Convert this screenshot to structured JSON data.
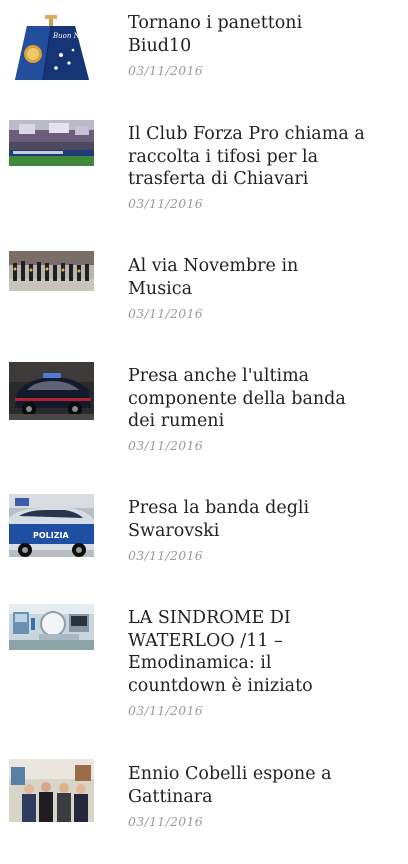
{
  "news": [
    {
      "title": "Tornano i panettoni\nBiud10",
      "date": "03/11/2016",
      "thumbnail_icon": "panettone-box-image",
      "logo_text": "Buon Natale"
    },
    {
      "title": "Il Club Forza Pro chiama a\nraccolta i tifosi per la\ntrasferta di Chiavari",
      "date": "03/11/2016",
      "thumbnail_icon": "stadium-fans-image"
    },
    {
      "title": "Al via Novembre in\nMusica",
      "date": "03/11/2016",
      "thumbnail_icon": "marching-band-image"
    },
    {
      "title": "Presa anche l'ultima\ncomponente della banda\ndei rumeni",
      "date": "03/11/2016",
      "thumbnail_icon": "carabinieri-car-image"
    },
    {
      "title": "Presa la banda degli\nSwarovski",
      "date": "03/11/2016",
      "thumbnail_icon": "police-car-image",
      "car_text": "POLIZIA"
    },
    {
      "title": "LA SINDROME DI\nWATERLOO /11 –\nEmodinamica: il\ncountdown è iniziato",
      "date": "03/11/2016",
      "thumbnail_icon": "hospital-room-image"
    },
    {
      "title": "Ennio Cobelli espone a\nGattinara",
      "date": "03/11/2016",
      "thumbnail_icon": "group-photo-image"
    }
  ]
}
